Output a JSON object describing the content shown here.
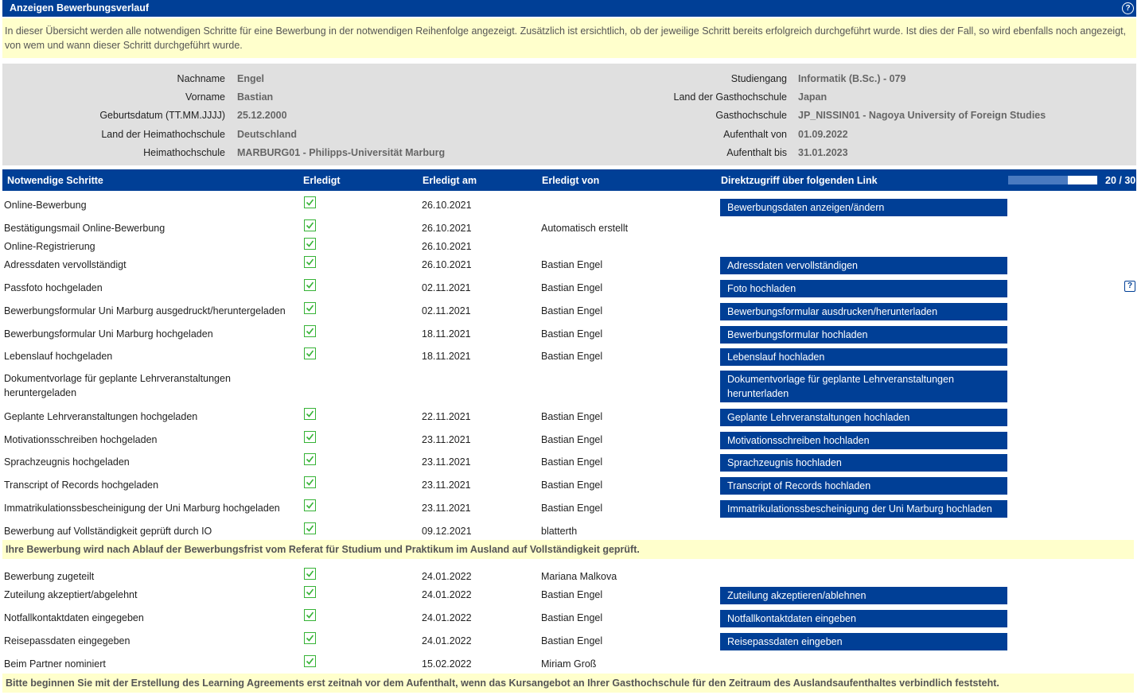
{
  "header": {
    "title": "Anzeigen Bewerbungsverlauf",
    "help_glyph": "?"
  },
  "info_text": "In dieser Übersicht werden alle notwendigen Schritte für eine Bewerbung in der notwendigen Reihenfolge angezeigt. Zusätzlich ist ersichtlich, ob der jeweilige Schritt bereits erfolgreich durchgeführt wurde. Ist dies der Fall, so wird ebenfalls noch angezeigt, von wem und wann dieser Schritt durchgeführt wurde.",
  "person": {
    "left": [
      {
        "label": "Nachname",
        "value": "Engel"
      },
      {
        "label": "Vorname",
        "value": "Bastian"
      },
      {
        "label": "Geburtsdatum (TT.MM.JJJJ)",
        "value": "25.12.2000"
      },
      {
        "label": "Land der Heimathochschule",
        "value": "Deutschland"
      },
      {
        "label": "Heimathochschule",
        "value": "MARBURG01 - Philipps-Universität Marburg"
      }
    ],
    "right": [
      {
        "label": "Studiengang",
        "value": "Informatik (B.Sc.) - 079"
      },
      {
        "label": "Land der Gasthochschule",
        "value": "Japan"
      },
      {
        "label": "Gasthochschule",
        "value": "JP_NISSIN01 - Nagoya University of Foreign Studies"
      },
      {
        "label": "Aufenthalt von",
        "value": "01.09.2022"
      },
      {
        "label": "Aufenthalt bis",
        "value": "31.01.2023"
      }
    ]
  },
  "table": {
    "headers": {
      "step": "Notwendige Schritte",
      "done": "Erledigt",
      "done_on": "Erledigt am",
      "done_by": "Erledigt von",
      "link": "Direktzugriff über folgenden Link"
    },
    "progress": {
      "done": 20,
      "total": 30,
      "label": "20 / 30"
    },
    "rows": [
      {
        "step": "Online-Bewerbung",
        "done": true,
        "date": "26.10.2021",
        "by": "",
        "link": "Bewerbungsdaten anzeigen/ändern"
      },
      {
        "step": "Bestätigungsmail Online-Bewerbung",
        "done": true,
        "date": "26.10.2021",
        "by": "Automatisch erstellt",
        "link": ""
      },
      {
        "step": "Online-Registrierung",
        "done": true,
        "date": "26.10.2021",
        "by": "",
        "link": ""
      },
      {
        "step": "Adressdaten vervollständigt",
        "done": true,
        "date": "26.10.2021",
        "by": "Bastian Engel",
        "link": "Adressdaten vervollständigen"
      },
      {
        "step": "Passfoto hochgeladen",
        "done": true,
        "date": "02.11.2021",
        "by": "Bastian Engel",
        "link": "Foto hochladen",
        "help": true
      },
      {
        "step": "Bewerbungsformular Uni Marburg ausgedruckt/heruntergeladen",
        "done": true,
        "date": "02.11.2021",
        "by": "Bastian Engel",
        "link": "Bewerbungsformular ausdrucken/herunterladen"
      },
      {
        "step": "Bewerbungsformular Uni Marburg hochgeladen",
        "done": true,
        "date": "18.11.2021",
        "by": "Bastian Engel",
        "link": "Bewerbungsformular hochladen"
      },
      {
        "step": "Lebenslauf hochgeladen",
        "done": true,
        "date": "18.11.2021",
        "by": "Bastian Engel",
        "link": "Lebenslauf hochladen"
      },
      {
        "step": "Dokumentvorlage für geplante Lehrveranstaltungen heruntergeladen",
        "done": false,
        "date": "",
        "by": "",
        "link": "Dokumentvorlage für geplante Lehrveranstaltungen herunterladen"
      },
      {
        "step": "Geplante Lehrveranstaltungen hochgeladen",
        "done": true,
        "date": "22.11.2021",
        "by": "Bastian Engel",
        "link": "Geplante Lehrveranstaltungen hochladen"
      },
      {
        "step": "Motivationsschreiben hochgeladen",
        "done": true,
        "date": "23.11.2021",
        "by": "Bastian Engel",
        "link": "Motivationsschreiben hochladen"
      },
      {
        "step": "Sprachzeugnis hochgeladen",
        "done": true,
        "date": "23.11.2021",
        "by": "Bastian Engel",
        "link": "Sprachzeugnis hochladen"
      },
      {
        "step": "Transcript of Records hochgeladen",
        "done": true,
        "date": "23.11.2021",
        "by": "Bastian Engel",
        "link": "Transcript of Records hochladen"
      },
      {
        "step": "Immatrikulationssbescheinigung der Uni Marburg hochgeladen",
        "done": true,
        "date": "23.11.2021",
        "by": "Bastian Engel",
        "link": "Immatrikulationssbescheinigung der Uni Marburg hochladen"
      },
      {
        "step": "Bewerbung auf Vollständigkeit geprüft durch IO",
        "done": true,
        "date": "09.12.2021",
        "by": "blatterth",
        "link": ""
      },
      {
        "note": "Ihre Bewerbung wird nach Ablauf der Bewerbungsfrist vom Referat für Studium und Praktikum im Ausland auf Vollständigkeit geprüft."
      },
      {
        "step": "Bewerbung zugeteilt",
        "done": true,
        "date": "24.01.2022",
        "by": "Mariana Malkova",
        "link": ""
      },
      {
        "step": "Zuteilung akzeptiert/abgelehnt",
        "done": true,
        "date": "24.01.2022",
        "by": "Bastian Engel",
        "link": "Zuteilung akzeptieren/ablehnen"
      },
      {
        "step": "Notfallkontaktdaten eingegeben",
        "done": true,
        "date": "24.01.2022",
        "by": "Bastian Engel",
        "link": "Notfallkontaktdaten eingeben"
      },
      {
        "step": "Reisepassdaten eingegeben",
        "done": true,
        "date": "24.01.2022",
        "by": "Bastian Engel",
        "link": "Reisepassdaten eingeben"
      },
      {
        "step": "Beim Partner nominiert",
        "done": true,
        "date": "15.02.2022",
        "by": "Miriam Groß",
        "link": ""
      },
      {
        "note": "Bitte beginnen Sie mit der Erstellung des Learning Agreements erst zeitnah vor dem Aufenthalt, wenn das Kursangebot an Ihrer Gasthochschule für den Zeitraum des Auslandsaufenthaltes verbindlich feststeht."
      }
    ]
  },
  "icons": {
    "help": "help-circle-icon",
    "collapse": "chevron-down-icon",
    "checkbox": "checkbox-checked-icon",
    "help_box": "help-box-icon"
  },
  "colors": {
    "header_bg": "#003f96",
    "info_bg": "#ffffcc",
    "person_bg": "#e0e0e0",
    "check": "#36b336"
  }
}
